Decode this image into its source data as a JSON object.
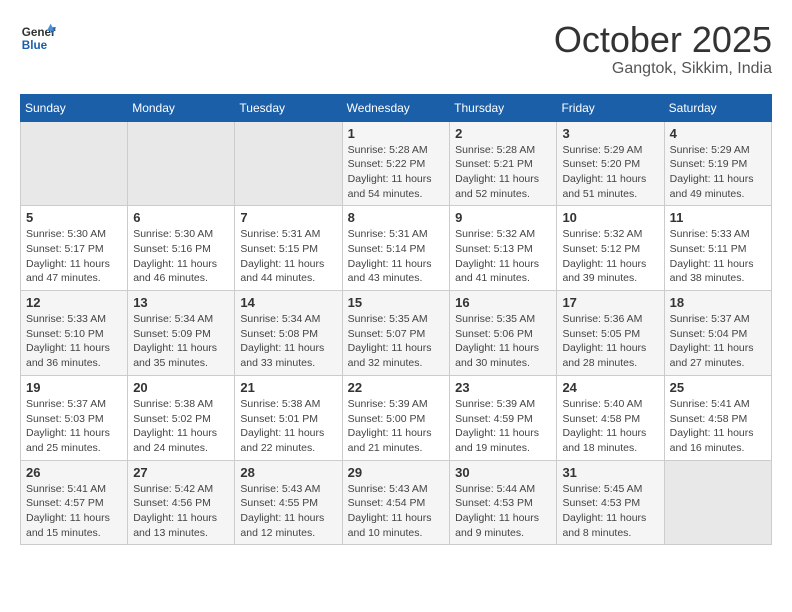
{
  "header": {
    "logo_general": "General",
    "logo_blue": "Blue",
    "month_title": "October 2025",
    "location": "Gangtok, Sikkim, India"
  },
  "weekdays": [
    "Sunday",
    "Monday",
    "Tuesday",
    "Wednesday",
    "Thursday",
    "Friday",
    "Saturday"
  ],
  "weeks": [
    [
      {
        "day": "",
        "info": ""
      },
      {
        "day": "",
        "info": ""
      },
      {
        "day": "",
        "info": ""
      },
      {
        "day": "1",
        "info": "Sunrise: 5:28 AM\nSunset: 5:22 PM\nDaylight: 11 hours\nand 54 minutes."
      },
      {
        "day": "2",
        "info": "Sunrise: 5:28 AM\nSunset: 5:21 PM\nDaylight: 11 hours\nand 52 minutes."
      },
      {
        "day": "3",
        "info": "Sunrise: 5:29 AM\nSunset: 5:20 PM\nDaylight: 11 hours\nand 51 minutes."
      },
      {
        "day": "4",
        "info": "Sunrise: 5:29 AM\nSunset: 5:19 PM\nDaylight: 11 hours\nand 49 minutes."
      }
    ],
    [
      {
        "day": "5",
        "info": "Sunrise: 5:30 AM\nSunset: 5:17 PM\nDaylight: 11 hours\nand 47 minutes."
      },
      {
        "day": "6",
        "info": "Sunrise: 5:30 AM\nSunset: 5:16 PM\nDaylight: 11 hours\nand 46 minutes."
      },
      {
        "day": "7",
        "info": "Sunrise: 5:31 AM\nSunset: 5:15 PM\nDaylight: 11 hours\nand 44 minutes."
      },
      {
        "day": "8",
        "info": "Sunrise: 5:31 AM\nSunset: 5:14 PM\nDaylight: 11 hours\nand 43 minutes."
      },
      {
        "day": "9",
        "info": "Sunrise: 5:32 AM\nSunset: 5:13 PM\nDaylight: 11 hours\nand 41 minutes."
      },
      {
        "day": "10",
        "info": "Sunrise: 5:32 AM\nSunset: 5:12 PM\nDaylight: 11 hours\nand 39 minutes."
      },
      {
        "day": "11",
        "info": "Sunrise: 5:33 AM\nSunset: 5:11 PM\nDaylight: 11 hours\nand 38 minutes."
      }
    ],
    [
      {
        "day": "12",
        "info": "Sunrise: 5:33 AM\nSunset: 5:10 PM\nDaylight: 11 hours\nand 36 minutes."
      },
      {
        "day": "13",
        "info": "Sunrise: 5:34 AM\nSunset: 5:09 PM\nDaylight: 11 hours\nand 35 minutes."
      },
      {
        "day": "14",
        "info": "Sunrise: 5:34 AM\nSunset: 5:08 PM\nDaylight: 11 hours\nand 33 minutes."
      },
      {
        "day": "15",
        "info": "Sunrise: 5:35 AM\nSunset: 5:07 PM\nDaylight: 11 hours\nand 32 minutes."
      },
      {
        "day": "16",
        "info": "Sunrise: 5:35 AM\nSunset: 5:06 PM\nDaylight: 11 hours\nand 30 minutes."
      },
      {
        "day": "17",
        "info": "Sunrise: 5:36 AM\nSunset: 5:05 PM\nDaylight: 11 hours\nand 28 minutes."
      },
      {
        "day": "18",
        "info": "Sunrise: 5:37 AM\nSunset: 5:04 PM\nDaylight: 11 hours\nand 27 minutes."
      }
    ],
    [
      {
        "day": "19",
        "info": "Sunrise: 5:37 AM\nSunset: 5:03 PM\nDaylight: 11 hours\nand 25 minutes."
      },
      {
        "day": "20",
        "info": "Sunrise: 5:38 AM\nSunset: 5:02 PM\nDaylight: 11 hours\nand 24 minutes."
      },
      {
        "day": "21",
        "info": "Sunrise: 5:38 AM\nSunset: 5:01 PM\nDaylight: 11 hours\nand 22 minutes."
      },
      {
        "day": "22",
        "info": "Sunrise: 5:39 AM\nSunset: 5:00 PM\nDaylight: 11 hours\nand 21 minutes."
      },
      {
        "day": "23",
        "info": "Sunrise: 5:39 AM\nSunset: 4:59 PM\nDaylight: 11 hours\nand 19 minutes."
      },
      {
        "day": "24",
        "info": "Sunrise: 5:40 AM\nSunset: 4:58 PM\nDaylight: 11 hours\nand 18 minutes."
      },
      {
        "day": "25",
        "info": "Sunrise: 5:41 AM\nSunset: 4:58 PM\nDaylight: 11 hours\nand 16 minutes."
      }
    ],
    [
      {
        "day": "26",
        "info": "Sunrise: 5:41 AM\nSunset: 4:57 PM\nDaylight: 11 hours\nand 15 minutes."
      },
      {
        "day": "27",
        "info": "Sunrise: 5:42 AM\nSunset: 4:56 PM\nDaylight: 11 hours\nand 13 minutes."
      },
      {
        "day": "28",
        "info": "Sunrise: 5:43 AM\nSunset: 4:55 PM\nDaylight: 11 hours\nand 12 minutes."
      },
      {
        "day": "29",
        "info": "Sunrise: 5:43 AM\nSunset: 4:54 PM\nDaylight: 11 hours\nand 10 minutes."
      },
      {
        "day": "30",
        "info": "Sunrise: 5:44 AM\nSunset: 4:53 PM\nDaylight: 11 hours\nand 9 minutes."
      },
      {
        "day": "31",
        "info": "Sunrise: 5:45 AM\nSunset: 4:53 PM\nDaylight: 11 hours\nand 8 minutes."
      },
      {
        "day": "",
        "info": ""
      }
    ]
  ]
}
